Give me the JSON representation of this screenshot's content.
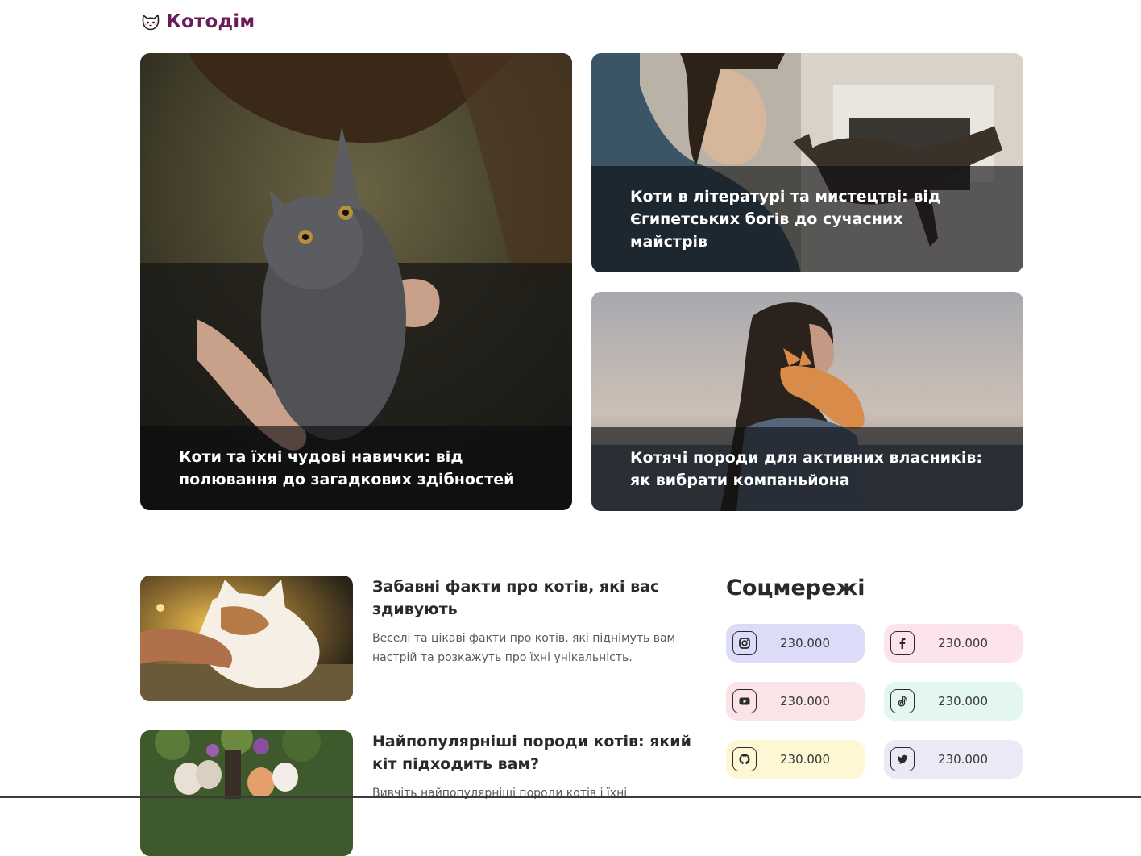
{
  "brand": {
    "name": "Котодім"
  },
  "hero": [
    {
      "title": "Коти та їхні чудові навички: від полювання до загадкових здібностей"
    },
    {
      "title": "Коти в літературі та мистецтві: від Єгипетських богів до сучасних майстрів"
    },
    {
      "title": "Котячі породи для активних власників: як вибрати компаньйона"
    }
  ],
  "articles": [
    {
      "title": "Забавні факти про котів, які вас здивують",
      "description": "Веселі та цікаві факти про котів, які піднімуть вам настрій та розкажуть про їхні унікальність."
    },
    {
      "title": "Найпопулярніші породи котів: який кіт підходить вам?",
      "description": "Вивчіть найпопулярніші породи котів і їхні"
    }
  ],
  "social": {
    "title": "Соцмережі",
    "items": [
      {
        "icon": "instagram-icon",
        "count": "230.000",
        "bg": "#dcdcf8"
      },
      {
        "icon": "facebook-icon",
        "count": "230.000",
        "bg": "#fde4ec"
      },
      {
        "icon": "youtube-icon",
        "count": "230.000",
        "bg": "#fbe4e8"
      },
      {
        "icon": "tiktok-icon",
        "count": "230.000",
        "bg": "#e3f6f1"
      },
      {
        "icon": "github-icon",
        "count": "230.000",
        "bg": "#fdf7d4"
      },
      {
        "icon": "twitter-icon",
        "count": "230.000",
        "bg": "#ece8f5"
      }
    ]
  }
}
